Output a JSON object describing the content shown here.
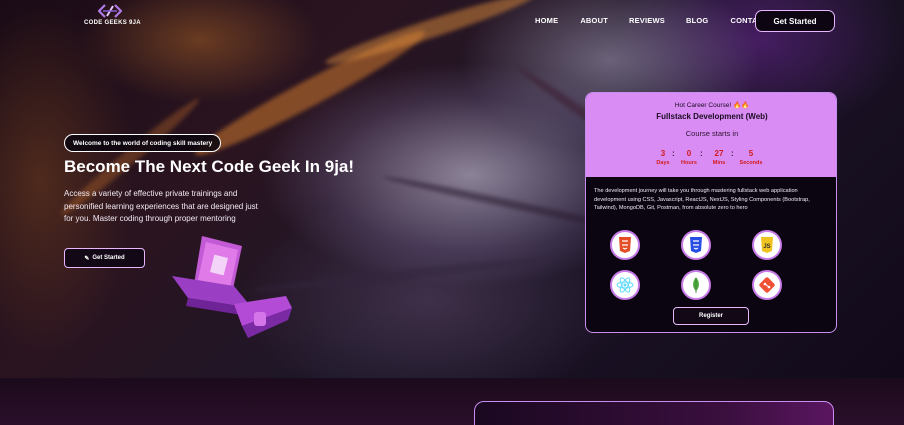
{
  "nav": {
    "logo_text": "CODE GEEKS 9JA",
    "links": [
      "HOME",
      "ABOUT",
      "REVIEWS",
      "BLOG",
      "CONTACT"
    ],
    "cta": "Get Started"
  },
  "hero": {
    "badge": "Welcome to the world of coding skill mastery",
    "title": "Become The Next Code Geek In 9ja!",
    "description": "Access a variety of effective private trainings and personified learning experiences that are designed just for you. Master coding through proper mentoring",
    "button": "Get Started",
    "button_icon": "pencil-square-icon"
  },
  "course_card": {
    "hot_label": "Hot Career Course! 🔥🔥",
    "title": "Fullstack Development (Web)",
    "starts_in": "Course starts in",
    "countdown": {
      "days": "3",
      "days_label": "Days",
      "hours": "0",
      "hours_label": "Hours",
      "mins": "27",
      "mins_label": "Mins",
      "seconds": "5",
      "seconds_label": "Seconds"
    },
    "description": "The development journey will take you through mastering fullstack web application development using CSS, Javascript, ReactJS, NextJS, Styling Components (Bootstrap, Tailwind), MongoDB, Git, Postman, from absolute zero to hero",
    "technologies": [
      "html5-icon",
      "css3-icon",
      "javascript-icon",
      "react-icon",
      "mongodb-icon",
      "git-icon"
    ],
    "register": "Register"
  },
  "colors": {
    "accent": "#d98cf4",
    "border": "#e7b6ff",
    "countdown": "#d21b1b"
  }
}
